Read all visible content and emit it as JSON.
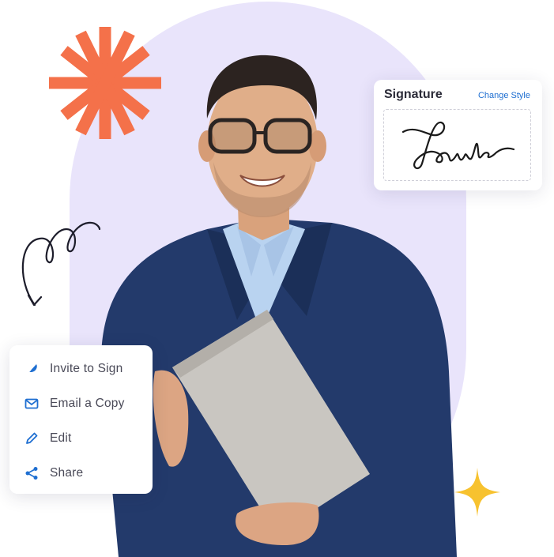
{
  "signature_card": {
    "title": "Signature",
    "change_style_label": "Change Style"
  },
  "menu": {
    "items": [
      {
        "label": "Invite to Sign",
        "icon": "feather-pen-icon"
      },
      {
        "label": "Email a Copy",
        "icon": "envelope-icon"
      },
      {
        "label": "Edit",
        "icon": "pencil-icon"
      },
      {
        "label": "Share",
        "icon": "share-icon"
      }
    ]
  },
  "colors": {
    "backdrop": "#e9e4fb",
    "asterisk": "#f4714a",
    "sparkle": "#f7c22f",
    "link": "#1f6fd1",
    "icon_blue": "#1f6fd1",
    "suit": "#233a6b",
    "shirt": "#b9d3f0",
    "laptop": "#c9c6c1"
  }
}
